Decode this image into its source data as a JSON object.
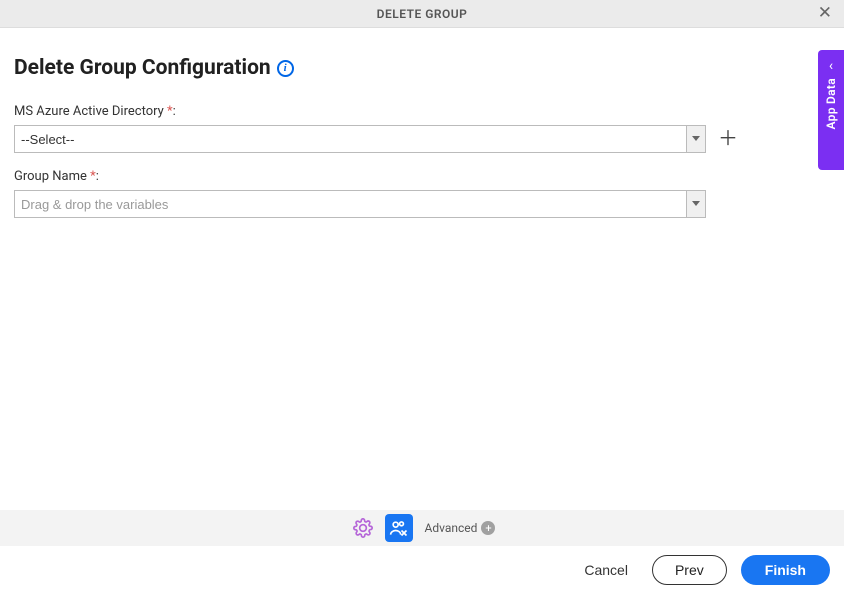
{
  "header": {
    "title": "DELETE GROUP"
  },
  "page": {
    "title": "Delete Group Configuration"
  },
  "fields": {
    "azure": {
      "label": "MS Azure Active Directory ",
      "required": "*",
      "value": "--Select--"
    },
    "group_name": {
      "label": "Group Name ",
      "required": "*",
      "placeholder": "Drag & drop the variables",
      "value": ""
    }
  },
  "side_tab": {
    "label": "App Data"
  },
  "footer_strip": {
    "advanced_label": "Advanced"
  },
  "buttons": {
    "cancel": "Cancel",
    "prev": "Prev",
    "finish": "Finish"
  }
}
